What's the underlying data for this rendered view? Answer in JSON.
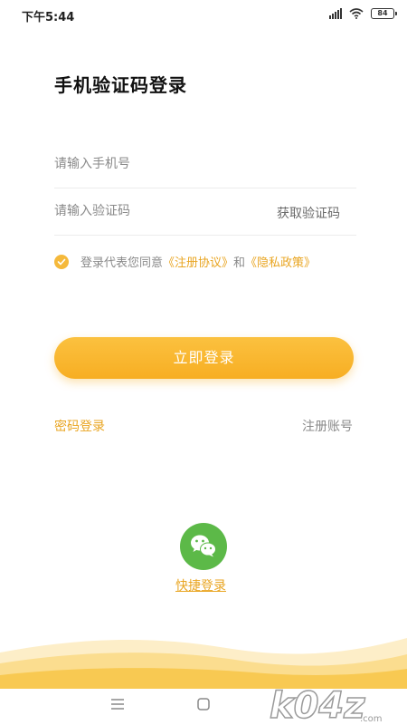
{
  "status_bar": {
    "time": "下午5:44",
    "battery": "84"
  },
  "title": "手机验证码登录",
  "phone_field": {
    "placeholder": "请输入手机号",
    "value": ""
  },
  "code_field": {
    "placeholder": "请输入验证码",
    "value": "",
    "get_code_label": "获取验证码"
  },
  "agreement": {
    "checked": true,
    "prefix": "登录代表您同意",
    "terms_link": "《注册协议》",
    "conjunction": "和",
    "privacy_link": "《隐私政策》"
  },
  "login_button_label": "立即登录",
  "password_login_label": "密码登录",
  "register_label": "注册账号",
  "quick_login": {
    "icon": "wechat-icon",
    "label": "快捷登录"
  },
  "watermark": "k04z.com",
  "colors": {
    "accent": "#f7ae23",
    "link": "#e9a521",
    "wechat": "#5cb948"
  }
}
